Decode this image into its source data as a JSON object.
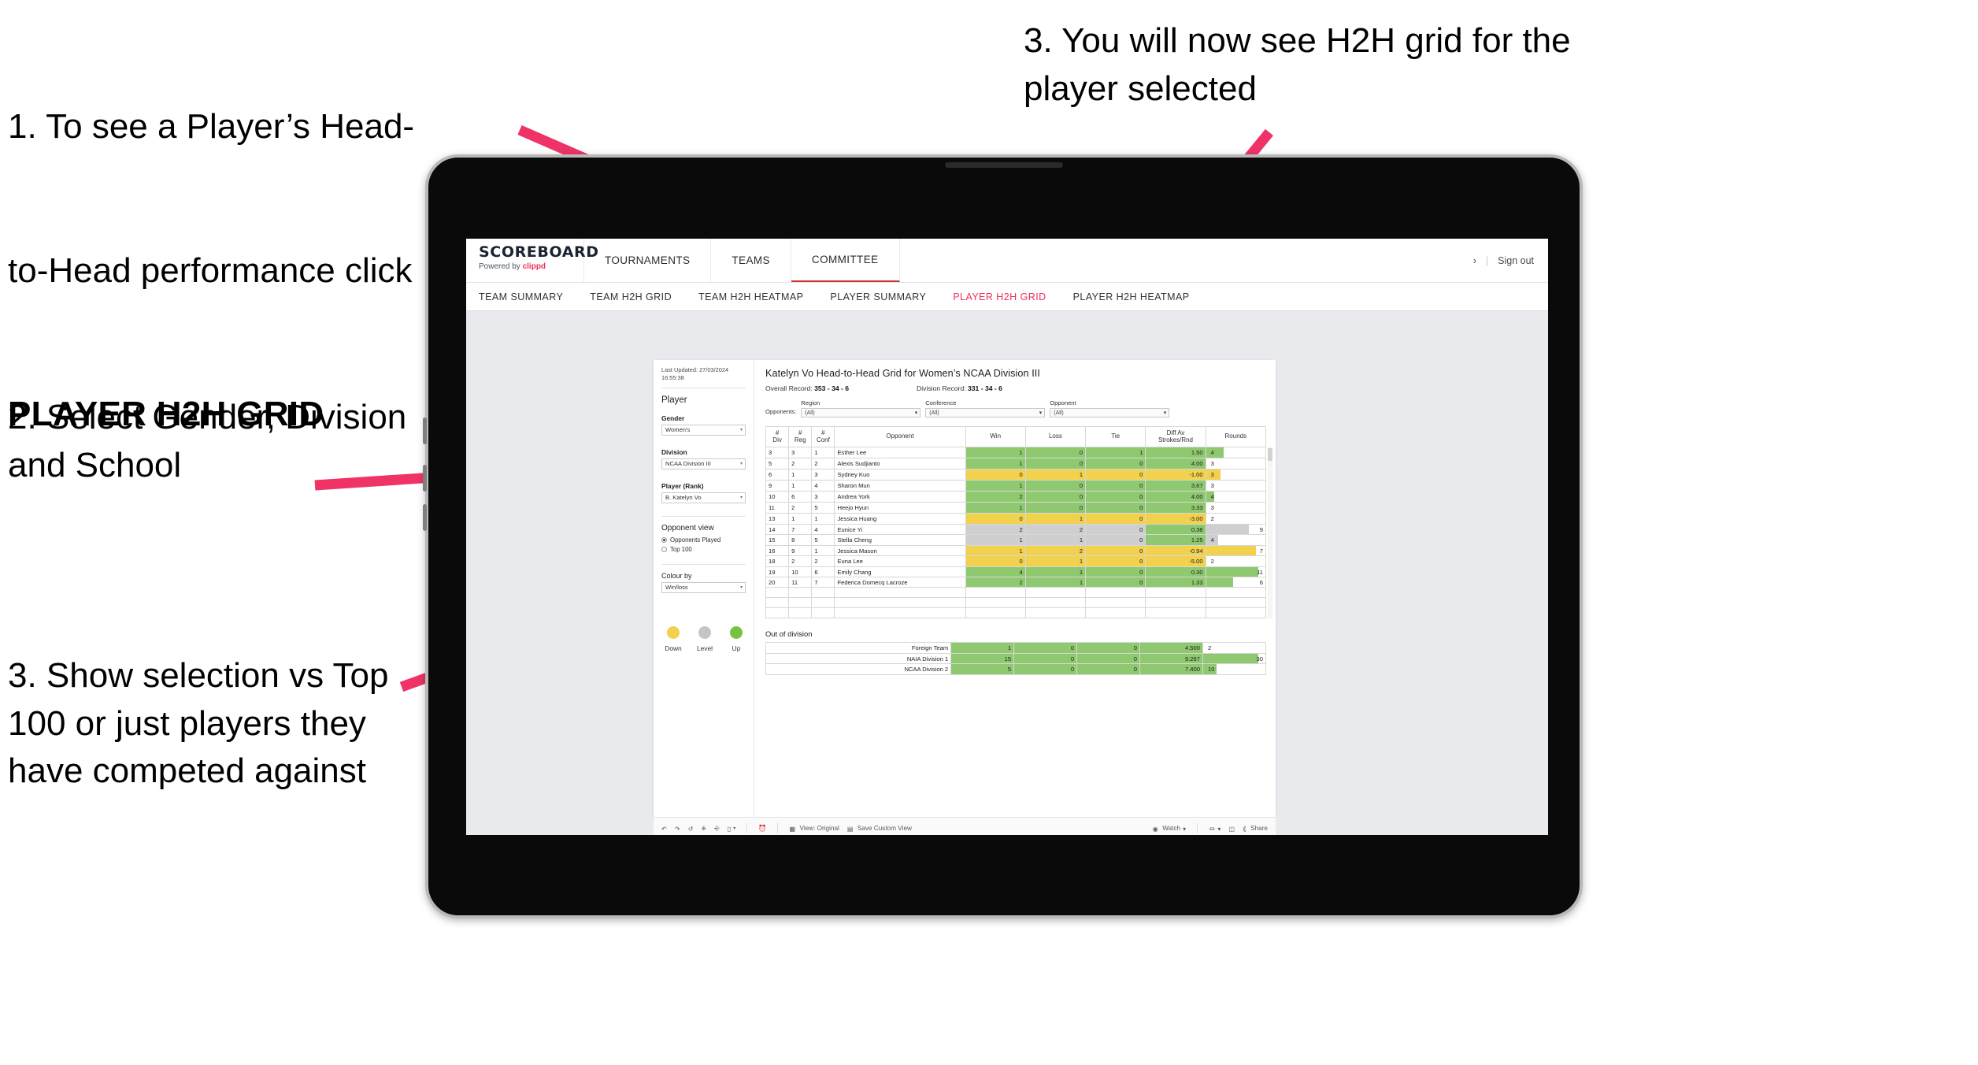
{
  "annotations": [
    {
      "id": "anno-1",
      "line1": "1. To see a Player’s Head-",
      "line2": "to-Head performance click",
      "bold": "PLAYER H2H GRID"
    },
    {
      "id": "anno-2",
      "text": "2. Select Gender, Division and School"
    },
    {
      "id": "anno-3",
      "text": "3. Show selection vs Top 100 or just players they have competed against"
    },
    {
      "id": "anno-4",
      "text": "3. You will now see H2H grid for the player selected"
    }
  ],
  "colors": {
    "accent_pink": "#ef2f5a",
    "arrow_pink": "#ef3366",
    "win_green": "#8fc96f",
    "loss_yellow": "#f2d14e",
    "level_grey": "#cfcfcf",
    "tablet_body": "#0a0a0a",
    "screen_bg": "#e8eaed"
  },
  "app": {
    "logo": {
      "main": "SCOREBOARD",
      "sub_prefix": "Powered by ",
      "sub_brand": "clippd"
    },
    "top_nav": [
      {
        "label": "TOURNAMENTS",
        "active": false
      },
      {
        "label": "TEAMS",
        "active": false
      },
      {
        "label": "COMMITTEE",
        "active": true
      }
    ],
    "top_right": {
      "caret": "›",
      "sep": "|",
      "signout": "Sign out"
    },
    "tabs": [
      {
        "label": "TEAM SUMMARY",
        "active": false
      },
      {
        "label": "TEAM H2H GRID",
        "active": false
      },
      {
        "label": "TEAM H2H HEATMAP",
        "active": false
      },
      {
        "label": "PLAYER SUMMARY",
        "active": false
      },
      {
        "label": "PLAYER H2H GRID",
        "active": true
      },
      {
        "label": "PLAYER H2H HEATMAP",
        "active": false
      }
    ]
  },
  "sidebar": {
    "last_updated": "Last Updated: 27/03/2024 16:55:38",
    "player_heading": "Player",
    "fields": [
      {
        "label": "Gender",
        "value": "Women's"
      },
      {
        "label": "Division",
        "value": "NCAA Division III"
      },
      {
        "label": "Player (Rank)",
        "value": "B. Katelyn Vo"
      }
    ],
    "opponent_view": {
      "heading": "Opponent view",
      "options": [
        {
          "label": "Opponents Played",
          "selected": true
        },
        {
          "label": "Top 100",
          "selected": false
        }
      ]
    },
    "colour_by": {
      "label": "Colour by",
      "value": "Win/loss"
    },
    "legend": [
      {
        "label": "Down",
        "color": "#f2d14e"
      },
      {
        "label": "Level",
        "color": "#cfcfcf"
      },
      {
        "label": "Up",
        "color": "#7ac143"
      }
    ]
  },
  "main": {
    "title": "Katelyn Vo Head-to-Head Grid for Women’s NCAA Division III",
    "overall_record_label": "Overall Record: ",
    "overall_record_value": "353 - 34 - 6",
    "division_record_label": "Division Record: ",
    "division_record_value": "331 - 34 - 6",
    "opponents_label": "Opponents:",
    "filters": [
      {
        "label": "Region",
        "value": "(All)"
      },
      {
        "label": "Conference",
        "value": "(All)"
      },
      {
        "label": "Opponent",
        "value": "(All)"
      }
    ],
    "columns": [
      "# Div",
      "# Reg",
      "# Conf",
      "Opponent",
      "Win",
      "Loss",
      "Tie",
      "Diff Av Strokes/Rnd",
      "Rounds"
    ],
    "out_of_division_title": "Out of division"
  },
  "chart_data": {
    "type": "table",
    "title": "Katelyn Vo Head-to-Head Grid for Women’s NCAA Division III",
    "columns": [
      "# Div",
      "# Reg",
      "# Conf",
      "Opponent",
      "Win",
      "Loss",
      "Tie",
      "Diff Av Strokes/Rnd",
      "Rounds"
    ],
    "rows": [
      {
        "div": "3",
        "reg": "3",
        "conf": "1",
        "opponent": "Esther Lee",
        "win": "1",
        "loss": "0",
        "tie": "1",
        "diff": "1.50",
        "rounds": "4",
        "state": "win",
        "bar_pct": 30,
        "num_right": false
      },
      {
        "div": "5",
        "reg": "2",
        "conf": "2",
        "opponent": "Alexis Sudjianto",
        "win": "1",
        "loss": "0",
        "tie": "0",
        "diff": "4.00",
        "rounds": "3",
        "state": "win",
        "bar_pct": 0,
        "num_right": false
      },
      {
        "div": "6",
        "reg": "1",
        "conf": "3",
        "opponent": "Sydney Kuo",
        "win": "0",
        "loss": "1",
        "tie": "0",
        "diff": "-1.00",
        "rounds": "3",
        "state": "loss",
        "bar_pct": 25,
        "num_right": false
      },
      {
        "div": "9",
        "reg": "1",
        "conf": "4",
        "opponent": "Sharon Mun",
        "win": "1",
        "loss": "0",
        "tie": "0",
        "diff": "3.67",
        "rounds": "3",
        "state": "win",
        "bar_pct": 0,
        "num_right": false
      },
      {
        "div": "10",
        "reg": "6",
        "conf": "3",
        "opponent": "Andrea York",
        "win": "2",
        "loss": "0",
        "tie": "0",
        "diff": "4.00",
        "rounds": "4",
        "state": "win",
        "bar_pct": 14,
        "num_right": false
      },
      {
        "div": "11",
        "reg": "2",
        "conf": "5",
        "opponent": "Heejo Hyun",
        "win": "1",
        "loss": "0",
        "tie": "0",
        "diff": "3.33",
        "rounds": "3",
        "state": "win",
        "bar_pct": 0,
        "num_right": false
      },
      {
        "div": "13",
        "reg": "1",
        "conf": "1",
        "opponent": "Jessica Huang",
        "win": "0",
        "loss": "1",
        "tie": "0",
        "diff": "-3.00",
        "rounds": "2",
        "state": "loss",
        "bar_pct": 0,
        "num_right": false
      },
      {
        "div": "14",
        "reg": "7",
        "conf": "4",
        "opponent": "Eunice Yi",
        "win": "2",
        "loss": "2",
        "tie": "0",
        "diff": "0.38",
        "rounds": "9",
        "state": "level",
        "bar_pct": 72,
        "num_right": true
      },
      {
        "div": "15",
        "reg": "8",
        "conf": "5",
        "opponent": "Stella Cheng",
        "win": "1",
        "loss": "1",
        "tie": "0",
        "diff": "1.25",
        "rounds": "4",
        "state": "level",
        "bar_pct": 20,
        "num_right": false
      },
      {
        "div": "16",
        "reg": "9",
        "conf": "1",
        "opponent": "Jessica Mason",
        "win": "1",
        "loss": "2",
        "tie": "0",
        "diff": "-0.94",
        "rounds": "7",
        "state": "loss",
        "bar_pct": 84,
        "num_right": true
      },
      {
        "div": "18",
        "reg": "2",
        "conf": "2",
        "opponent": "Euna Lee",
        "win": "0",
        "loss": "1",
        "tie": "0",
        "diff": "-5.00",
        "rounds": "2",
        "state": "loss",
        "bar_pct": 0,
        "num_right": false
      },
      {
        "div": "19",
        "reg": "10",
        "conf": "6",
        "opponent": "Emily Chang",
        "win": "4",
        "loss": "1",
        "tie": "0",
        "diff": "0.30",
        "rounds": "11",
        "state": "win",
        "bar_pct": 88,
        "num_right": true
      },
      {
        "div": "20",
        "reg": "11",
        "conf": "7",
        "opponent": "Federica Domecq Lacroze",
        "win": "2",
        "loss": "1",
        "tie": "0",
        "diff": "1.33",
        "rounds": "6",
        "state": "win",
        "bar_pct": 45,
        "num_right": true
      }
    ],
    "out_of_division": {
      "title": "Out of division",
      "rows": [
        {
          "name": "Foreign Team",
          "win": "1",
          "loss": "0",
          "tie": "0",
          "diff": "4.500",
          "rounds": "2",
          "state": "win",
          "bar_pct": 0,
          "num_right": false
        },
        {
          "name": "NAIA Division 1",
          "win": "15",
          "loss": "0",
          "tie": "0",
          "diff": "9.267",
          "rounds": "30",
          "state": "win",
          "bar_pct": 88,
          "num_right": true
        },
        {
          "name": "NCAA Division 2",
          "win": "5",
          "loss": "0",
          "tie": "0",
          "diff": "7.400",
          "rounds": "10",
          "state": "win",
          "bar_pct": 22,
          "num_right": false
        }
      ]
    }
  },
  "toolbar": {
    "view_label": "View: Original",
    "save_label": "Save Custom View",
    "watch_label": "Watch",
    "share_label": "Share",
    "caret": "▾"
  }
}
